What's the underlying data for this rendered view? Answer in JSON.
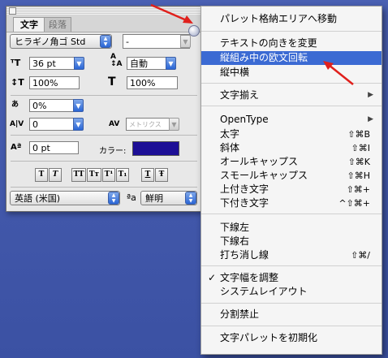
{
  "palette": {
    "tabs": [
      "文字",
      "段落"
    ],
    "font_family": "ヒラギノ角ゴ Std",
    "font_style": "-",
    "font_size": "36 pt",
    "leading": "自動",
    "vertical_scale": "100%",
    "horizontal_scale": "100%",
    "tsume": "0%",
    "kerning": "0",
    "tracking": "メトリクス",
    "baseline_shift": "0 pt",
    "color_label": "カラー:",
    "language": "英語 (米国)",
    "antialias_label": "ªa",
    "antialias": "鮮明",
    "style_buttons": [
      "T",
      "T",
      "TT",
      "Tт",
      "T¹",
      "T₁",
      "T",
      "Ŧ"
    ]
  },
  "menu": {
    "items": [
      {
        "label": "パレット格納エリアへ移動"
      },
      {
        "label": "テキストの向きを変更"
      },
      {
        "label": "縦組み中の欧文回転",
        "highlighted": true
      },
      {
        "label": "縦中横"
      },
      {
        "label": "文字揃え"
      },
      {
        "label": "OpenType"
      },
      {
        "label": "太字",
        "shortcut": "⇧⌘B"
      },
      {
        "label": "斜体",
        "shortcut": "⇧⌘I"
      },
      {
        "label": "オールキャップス",
        "shortcut": "⇧⌘K"
      },
      {
        "label": "スモールキャップス",
        "shortcut": "⇧⌘H"
      },
      {
        "label": "上付き文字",
        "shortcut": "⇧⌘+"
      },
      {
        "label": "下付き文字",
        "shortcut": "^⇧⌘+"
      },
      {
        "label": "下線左"
      },
      {
        "label": "下線右"
      },
      {
        "label": "打ち消し線",
        "shortcut": "⇧⌘/"
      },
      {
        "label": "文字幅を調整",
        "checked": "✓"
      },
      {
        "label": "システムレイアウト"
      },
      {
        "label": "分割禁止"
      },
      {
        "label": "文字パレットを初期化"
      }
    ],
    "submenu_arrow": "▶"
  },
  "colors": {
    "highlight": "#3b6ad3",
    "swatch": "#1d0f96",
    "arrow": "#e0201c"
  }
}
